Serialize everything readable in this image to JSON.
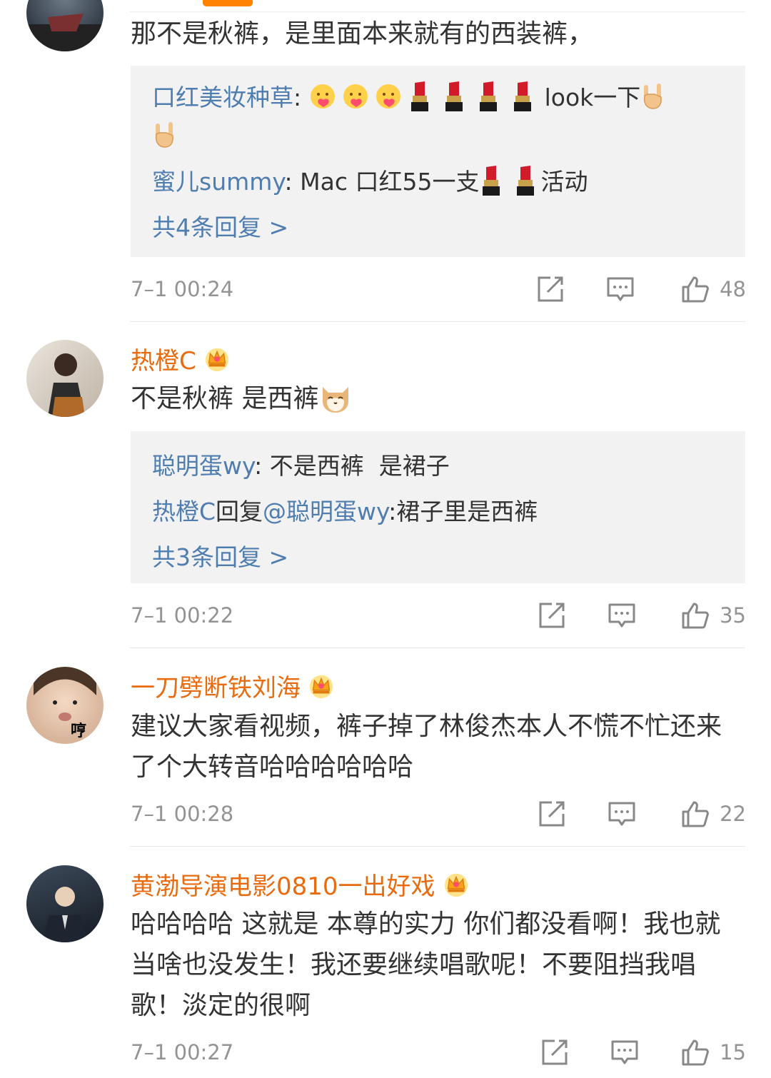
{
  "comments": [
    {
      "text": "那不是秋裤，是里面本来就有的西装裤，",
      "replies": [
        {
          "name": "口红美妆种草",
          "sep": ": ",
          "text": "look一下"
        },
        {
          "name": "蜜儿summy",
          "sep": ": ",
          "text": "Mac 口红55一支",
          "tail": "活动"
        }
      ],
      "more": "共4条回复 >",
      "time": "7–1 00:24",
      "likes": "48"
    },
    {
      "user": "热橙C",
      "text": "不是秋裤 是西裤",
      "replies": [
        {
          "name": "聪明蛋wy",
          "sep": ": ",
          "text": "不是西裤  是裙子"
        },
        {
          "name": "热橙C",
          "mid": "回复",
          "link": "@聪明蛋wy",
          "sep": ":",
          "text": "裙子里是西裤"
        }
      ],
      "more": "共3条回复 >",
      "time": "7–1 00:22",
      "likes": "35"
    },
    {
      "user": "一刀劈断铁刘海",
      "avatar_text": "哼",
      "text": "建议大家看视频，裤子掉了林俊杰本人不慌不忙还来了个大转音哈哈哈哈哈哈",
      "time": "7–1 00:28",
      "likes": "22"
    },
    {
      "user": "黄渤导演电影0810一出好戏",
      "text": "哈哈哈哈 这就是 本尊的实力 你们都没看啊！我也就当啥也没发生！我还要继续唱歌呢！不要阻挡我唱歌！淡定的很啊",
      "time": "7–1 00:27",
      "likes": "15"
    }
  ],
  "colors": {
    "username": "#e86b0f",
    "link": "#507daf",
    "meta": "#939393",
    "accent": "#ff8200"
  }
}
